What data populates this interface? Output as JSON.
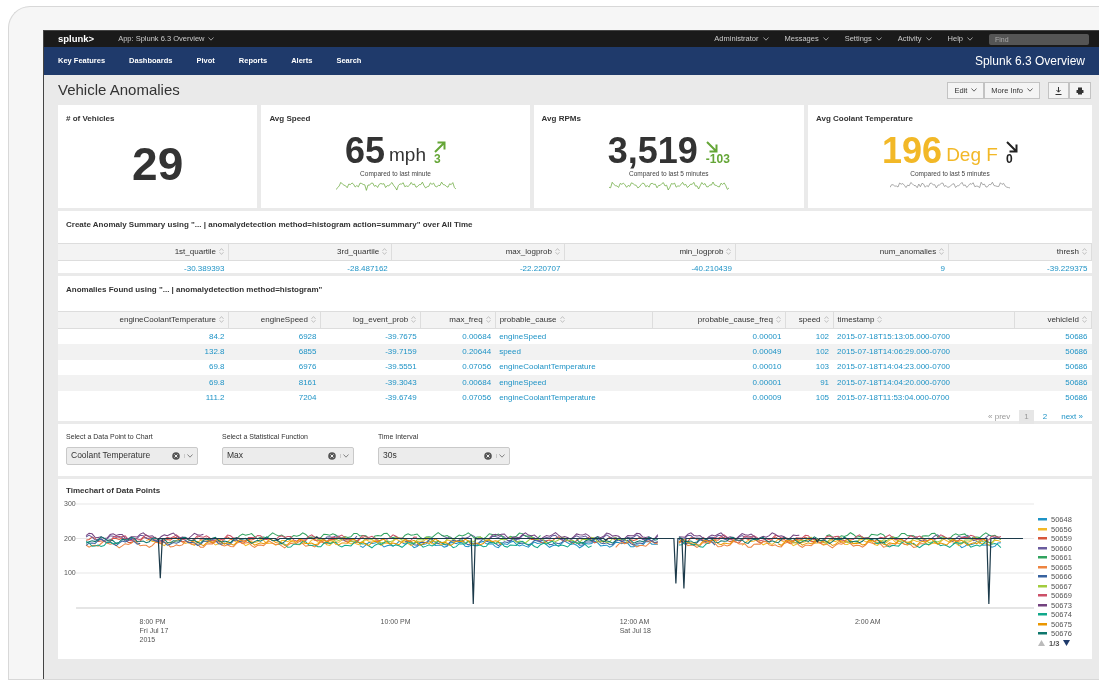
{
  "app_bar": {
    "logo": "splunk>",
    "app_menu": "App: Splunk 6.3 Overview",
    "menus": [
      "Administrator",
      "Messages",
      "Settings",
      "Activity",
      "Help"
    ],
    "search": {
      "placeholder": "Find"
    }
  },
  "nav": {
    "items": [
      "Key Features",
      "Dashboards",
      "Pivot",
      "Reports",
      "Alerts",
      "Search"
    ],
    "app_title": "Splunk 6.3 Overview"
  },
  "page": {
    "title": "Vehicle Anomalies",
    "buttons": [
      "Edit",
      "More Info"
    ]
  },
  "singles": [
    {
      "kind": "plain",
      "title": "# of Vehicles",
      "value": "29"
    },
    {
      "kind": "trend",
      "title": "Avg Speed",
      "value": "65",
      "unit": "mph",
      "rising": true,
      "favorable": true,
      "delta": "3",
      "caption": "Compared to last minute",
      "warning": false
    },
    {
      "kind": "trend",
      "title": "Avg RPMs",
      "value": "3,519",
      "rising": false,
      "favorable": true,
      "delta": "-103",
      "caption": "Compared to last 5 minutes",
      "warning": false
    },
    {
      "kind": "trend",
      "title": "Avg Coolant Temperature",
      "value": "196",
      "unit": "Deg F",
      "rising": false,
      "favorable": false,
      "delta": "0",
      "caption": "Compared to last 5 minutes",
      "warning": true
    }
  ],
  "summary": {
    "title": "Create Anomaly Summary using \"... | anomalydetection method=histogram action=summary\" over All Time",
    "columns": [
      "1st_quartile",
      "3rd_quartile",
      "max_logprob",
      "min_logprob",
      "num_anomalies",
      "thresh"
    ],
    "rows": [
      [
        "-30.389393",
        "-28.487162",
        "-22.220707",
        "-40.210439",
        "9",
        "-39.229375"
      ]
    ]
  },
  "anomalies": {
    "title": "Anomalies Found using \"... | anomalydetection method=histogram\"",
    "columns": [
      "engineCoolantTemperature",
      "engineSpeed",
      "log_event_prob",
      "max_freq",
      "probable_cause",
      "probable_cause_freq",
      "speed",
      "timestamp",
      "vehicleId"
    ],
    "rows": [
      [
        "84.2",
        "6928",
        "-39.7675",
        "0.00684",
        "engineSpeed",
        "0.00001",
        "102",
        "2015-07-18T15:13:05.000-0700",
        "50686"
      ],
      [
        "132.8",
        "6855",
        "-39.7159",
        "0.20644",
        "speed",
        "0.00049",
        "102",
        "2015-07-18T14:06:29.000-0700",
        "50686"
      ],
      [
        "69.8",
        "6976",
        "-39.5551",
        "0.07056",
        "engineCoolantTemperature",
        "0.00010",
        "103",
        "2015-07-18T14:04:23.000-0700",
        "50686"
      ],
      [
        "69.8",
        "8161",
        "-39.3043",
        "0.00684",
        "engineSpeed",
        "0.00001",
        "91",
        "2015-07-18T14:04:20.000-0700",
        "50686"
      ],
      [
        "111.2",
        "7204",
        "-39.6749",
        "0.07056",
        "engineCoolantTemperature",
        "0.00009",
        "105",
        "2015-07-18T11:53:04.000-0700",
        "50686"
      ]
    ],
    "pagination": {
      "prev": "« prev",
      "pages": [
        {
          "label": "1",
          "selected": true
        },
        {
          "label": "2",
          "selected": false
        }
      ],
      "next": "next »"
    }
  },
  "inputs": [
    {
      "label": "Select a Data Point to Chart",
      "value": "Coolant Temperature"
    },
    {
      "label": "Select a Statistical Function",
      "value": "Max"
    },
    {
      "label": "Time Interval",
      "value": "30s"
    }
  ],
  "chart": {
    "title": "Timechart of Data Points",
    "yticks": [
      "300",
      "200",
      "100"
    ],
    "xticks": [
      {
        "lines": [
          "8:00 PM",
          "Fri Jul 17",
          "2015"
        ]
      },
      {
        "lines": [
          "10:00 PM"
        ]
      },
      {
        "lines": [
          "12:00 AM",
          "Sat Jul 18"
        ]
      },
      {
        "lines": [
          "2:00 AM"
        ]
      }
    ],
    "legend": [
      {
        "label": "50648",
        "color": "#1e93c6"
      },
      {
        "label": "50656",
        "color": "#f2b827"
      },
      {
        "label": "50659",
        "color": "#d6563c"
      },
      {
        "label": "50660",
        "color": "#6a5c9e"
      },
      {
        "label": "50661",
        "color": "#31a35f"
      },
      {
        "label": "50665",
        "color": "#ed8440"
      },
      {
        "label": "50666",
        "color": "#3863a0"
      },
      {
        "label": "50667",
        "color": "#a2cc3e"
      },
      {
        "label": "50669",
        "color": "#cc5068"
      },
      {
        "label": "50673",
        "color": "#73427f"
      },
      {
        "label": "50674",
        "color": "#11a88b"
      },
      {
        "label": "50675",
        "color": "#ea9600"
      },
      {
        "label": "50676",
        "color": "#0e776d"
      }
    ],
    "legend_page": "1/3"
  }
}
